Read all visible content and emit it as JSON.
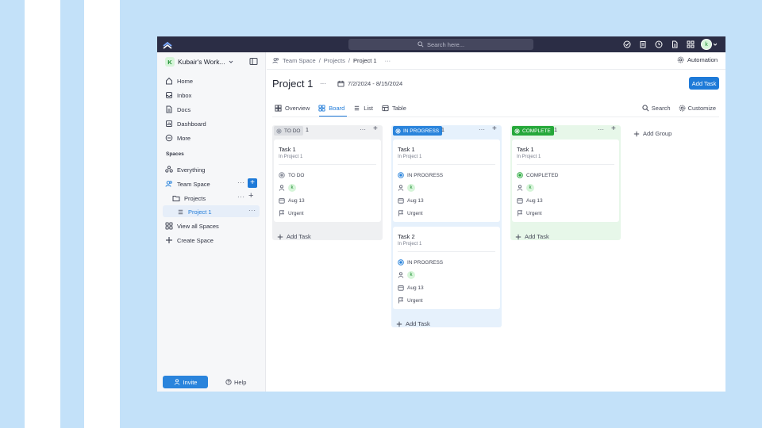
{
  "topbar": {
    "search_placeholder": "Search here...",
    "avatar_letter": "k"
  },
  "sidebar": {
    "workspace": {
      "badge": "K",
      "name": "Kubair's Work..."
    },
    "nav": [
      {
        "label": "Home",
        "icon": "home-icon"
      },
      {
        "label": "Inbox",
        "icon": "inbox-icon"
      },
      {
        "label": "Docs",
        "icon": "docs-icon"
      },
      {
        "label": "Dashboard",
        "icon": "dashboard-icon"
      },
      {
        "label": "More",
        "icon": "more-icon"
      }
    ],
    "spaces_heading": "Spaces",
    "everything": "Everything",
    "team_space": "Team Space",
    "projects": "Projects",
    "project1": "Project 1",
    "view_all_spaces": "View all Spaces",
    "create_space": "Create Space",
    "invite": "Invite",
    "help": "Help"
  },
  "breadcrumb": {
    "space": "Team Space",
    "sep": "/",
    "folder": "Projects",
    "list": "Project 1",
    "more": "···"
  },
  "automation": "Automation",
  "page": {
    "title": "Project 1",
    "dates": "7/2/2024 - 8/15/2024",
    "add_task": "Add Task"
  },
  "tabs": [
    {
      "label": "Overview"
    },
    {
      "label": "Board"
    },
    {
      "label": "List"
    },
    {
      "label": "Table"
    }
  ],
  "tools": {
    "search": "Search",
    "customize": "Customize"
  },
  "board": {
    "add_group": "Add Group",
    "add_task_label": "Add Task",
    "columns": [
      {
        "status": "TO DO",
        "count": "1",
        "color": "#8a8f9c",
        "bg": "#eff0f2",
        "tasks": [
          {
            "title": "Task 1",
            "location": "In Project 1",
            "status": "TO DO",
            "assignee": "k",
            "due": "Aug 13",
            "priority": "Urgent"
          }
        ]
      },
      {
        "status": "IN PROGRESS",
        "count": "1",
        "color": "#2a84dc",
        "bg": "#e6f1fc",
        "tasks": [
          {
            "title": "Task 1",
            "location": "In Project 1",
            "status": "IN PROGRESS",
            "assignee": "k",
            "due": "Aug 13",
            "priority": "Urgent"
          },
          {
            "title": "Task 2",
            "location": "In Project 1",
            "status": "IN PROGRESS",
            "assignee": "k",
            "due": "Aug 13",
            "priority": "Urgent"
          }
        ]
      },
      {
        "status": "COMPLETE",
        "count": "1",
        "color": "#26a83a",
        "bg": "#e7f7e9",
        "tasks": [
          {
            "title": "Task 1",
            "location": "In Project 1",
            "status": "COMPLETED",
            "assignee": "k",
            "due": "Aug 13",
            "priority": "Urgent"
          }
        ]
      }
    ]
  }
}
